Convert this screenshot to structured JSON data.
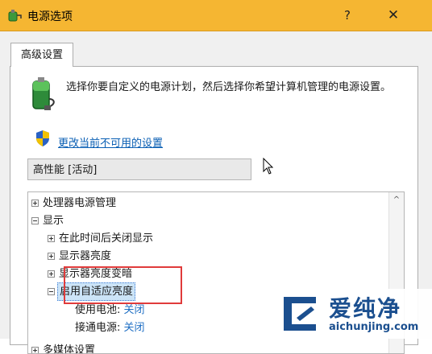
{
  "window": {
    "title": "电源选项",
    "help_label": "?",
    "close_label": "✕",
    "accent_color": "#f5b632"
  },
  "tabs": [
    {
      "label": "高级设置",
      "active": true
    }
  ],
  "intro": {
    "icon": "battery-plug-icon",
    "description": "选择你要自定义的电源计划，然后选择你希望计算机管理的电源设置。"
  },
  "change_link": {
    "icon": "uac-shield-icon",
    "label": "更改当前不可用的设置"
  },
  "plan_select": {
    "selected": "高性能 [活动]"
  },
  "tree": {
    "items": [
      {
        "label": "处理器电源管理",
        "expander": "+",
        "level": 0
      },
      {
        "label": "显示",
        "expander": "-",
        "level": 0
      },
      {
        "label": "在此时间后关闭显示",
        "expander": "+",
        "level": 1
      },
      {
        "label": "显示器亮度",
        "expander": "+",
        "level": 1
      },
      {
        "label": "显示器亮度变暗",
        "expander": "+",
        "level": 1
      },
      {
        "label": "启用自适应亮度",
        "expander": "-",
        "level": 1,
        "selected": true
      }
    ],
    "settings": [
      {
        "key": "使用电池:",
        "value": "关闭"
      },
      {
        "key": "接通电源:",
        "value": "关闭"
      }
    ],
    "partial_item": "多媒体设置",
    "scroll_up_label": "^"
  },
  "annotation": {
    "highlight_color": "#e03b3b"
  },
  "watermark": {
    "text": "爱纯净",
    "url": "aichunjing.com"
  }
}
